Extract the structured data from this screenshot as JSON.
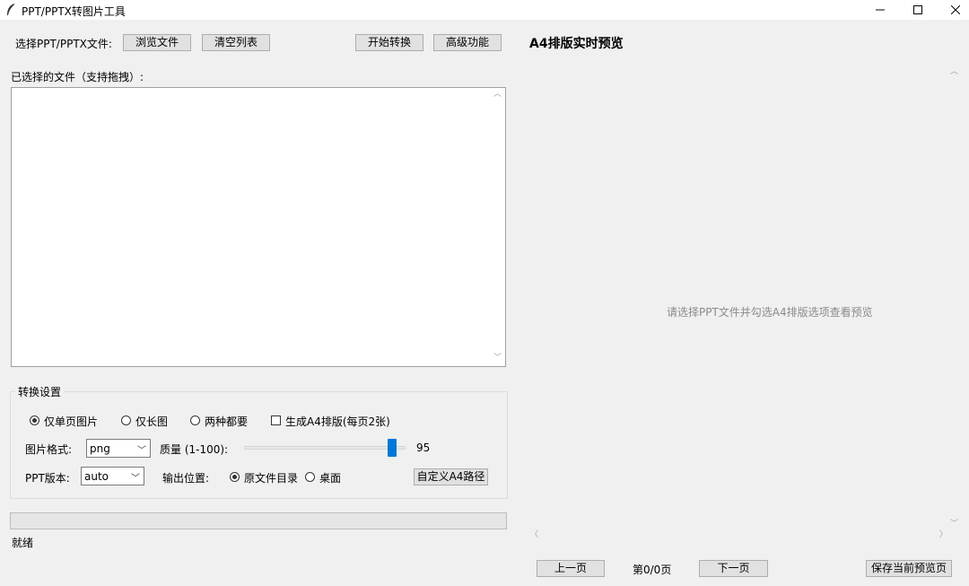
{
  "window": {
    "title": "PPT/PPTX转图片工具",
    "controls": {
      "minimize": "—",
      "maximize": "☐",
      "close": "✕"
    }
  },
  "toolbar": {
    "select_label": "选择PPT/PPTX文件:",
    "browse_button": "浏览文件",
    "clear_button": "清空列表",
    "start_button": "开始转换",
    "advanced_button": "高级功能"
  },
  "file_list": {
    "label": "已选择的文件（支持拖拽）:",
    "items": []
  },
  "settings": {
    "title": "转换设置",
    "mode_options": [
      "仅单页图片",
      "仅长图",
      "两种都要"
    ],
    "mode_selected": "仅单页图片",
    "a4_checkbox_label": "生成A4排版(每页2张)",
    "a4_checked": false,
    "format_label": "图片格式:",
    "format_value": "png",
    "quality_label": "质量 (1-100):",
    "quality_value": "95",
    "ppt_version_label": "PPT版本:",
    "ppt_version_value": "auto",
    "output_label": "输出位置:",
    "output_options": [
      "原文件目录",
      "桌面"
    ],
    "output_selected": "原文件目录",
    "custom_a4_button": "自定义A4路径"
  },
  "status": {
    "progress": 0,
    "text": "就绪"
  },
  "preview": {
    "title": "A4排版实时预览",
    "placeholder": "请选择PPT文件并勾选A4排版选项查看预览",
    "prev_button": "上一页",
    "page_indicator": "第0/0页",
    "next_button": "下一页",
    "save_button": "保存当前预览页"
  },
  "colors": {
    "window_bg": "#f0f0f0",
    "slider_thumb": "#0078d7",
    "button_bg": "#e1e1e1"
  }
}
